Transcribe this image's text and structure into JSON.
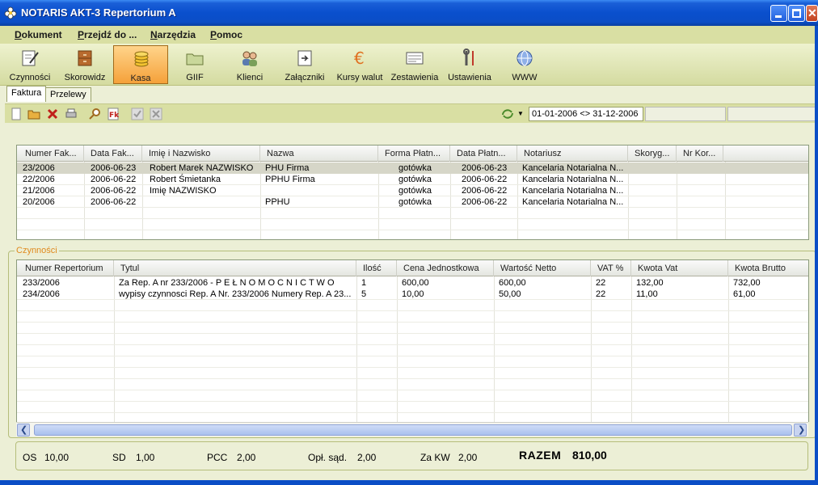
{
  "window": {
    "title": "NOTARIS AKT-3 Repertorium A"
  },
  "menu": [
    "Dokument",
    "Przejdź do ...",
    "Narzędzia",
    "Pomoc"
  ],
  "toolbar": [
    {
      "label": "Czynności",
      "icon": "notebook-pen-icon"
    },
    {
      "label": "Skorowidz",
      "icon": "cabinet-icon"
    },
    {
      "label": "Kasa",
      "icon": "coins-icon",
      "active": true
    },
    {
      "label": "GIIF",
      "icon": "folder-icon"
    },
    {
      "label": "Klienci",
      "icon": "people-icon"
    },
    {
      "label": "Załączniki",
      "icon": "attachment-icon"
    },
    {
      "label": "Kursy walut",
      "icon": "euro-icon"
    },
    {
      "label": "Zestawienia",
      "icon": "report-icon"
    },
    {
      "label": "Ustawienia",
      "icon": "tools-icon"
    },
    {
      "label": "WWW",
      "icon": "globe-icon"
    }
  ],
  "tabs": [
    "Faktura",
    "Przelewy"
  ],
  "filter": {
    "date_range": "01-01-2006 <> 31-12-2006"
  },
  "invoices": {
    "columns": [
      "Numer Fak...",
      "Data Fak...",
      "Imię i Nazwisko",
      "Nazwa",
      "Forma Płatn...",
      "Data Płatn...",
      "Notariusz",
      "Skoryg...",
      "Nr Kor..."
    ],
    "rows": [
      [
        "23/2006",
        "2006-06-23",
        "Robert Marek  NAZWISKO",
        "PHU Firma",
        "gotówka",
        "2006-06-23",
        "Kancelaria Notarialna N...",
        "",
        ""
      ],
      [
        "22/2006",
        "2006-06-22",
        "Robert  Śmietanka",
        "PPHU Firma",
        "gotówka",
        "2006-06-22",
        "Kancelaria Notarialna N...",
        "",
        ""
      ],
      [
        "21/2006",
        "2006-06-22",
        "Imię  NAZWISKO",
        "",
        "gotówka",
        "2006-06-22",
        "Kancelaria Notarialna N...",
        "",
        ""
      ],
      [
        "20/2006",
        "2006-06-22",
        "",
        "PPHU",
        "gotówka",
        "2006-06-22",
        "Kancelaria Notarialna N...",
        "",
        ""
      ]
    ]
  },
  "activities": {
    "section_label": "Czynności",
    "columns": [
      "Numer Repertorium",
      "Tytul",
      "Ilość",
      "Cena Jednostkowa",
      "Wartość Netto",
      "VAT %",
      "Kwota Vat",
      "Kwota Brutto"
    ],
    "rows": [
      [
        "233/2006",
        "Za Rep. A nr 233/2006 - P E Ł N O M O C N I C T W O",
        "1",
        "600,00",
        "600,00",
        "22",
        "132,00",
        "732,00"
      ],
      [
        "234/2006",
        "wypisy czynnosci Rep. A Nr. 233/2006 Numery Rep. A 23...",
        "5",
        "10,00",
        "50,00",
        "22",
        "11,00",
        "61,00"
      ]
    ]
  },
  "summary": {
    "os_label": "OS",
    "os_value": "10,00",
    "sd_label": "SD",
    "sd_value": "1,00",
    "pcc_label": "PCC",
    "pcc_value": "2,00",
    "opl_label": "Opł. sąd.",
    "opl_value": "2,00",
    "zakw_label": "Za KW",
    "zakw_value": "2,00",
    "razem_label": "RAZEM",
    "razem_value": "810,00"
  },
  "colors": {
    "titlebar": "#0b4ec6",
    "menubar": "#d9dfa3",
    "active_button": "#f5a13a",
    "section_label": "#e08a1e"
  }
}
